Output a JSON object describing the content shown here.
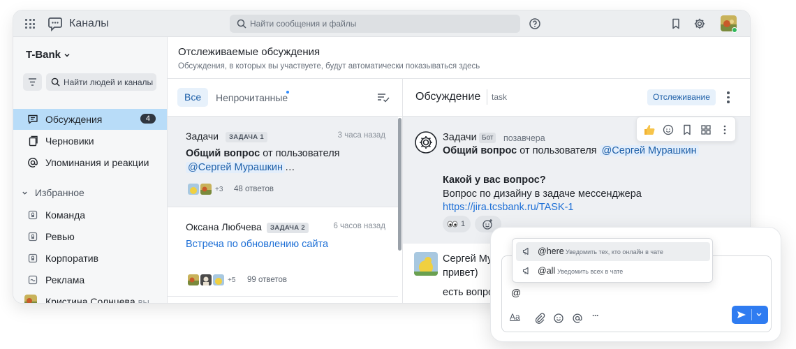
{
  "app": {
    "title": "Каналы",
    "search_placeholder": "Найти сообщения и файлы"
  },
  "sidebar": {
    "workspace": "T-Bank",
    "search_label": "Найти людей и каналы",
    "nav": [
      {
        "label": "Обсуждения",
        "count": "4",
        "icon": "threads-icon"
      },
      {
        "label": "Черновики",
        "icon": "drafts-icon"
      },
      {
        "label": "Упоминания и реакции",
        "icon": "at-icon"
      }
    ],
    "favorites_label": "Избранное",
    "channels": [
      {
        "label": "Команда",
        "icon": "lock-icon"
      },
      {
        "label": "Ревью",
        "icon": "lock-icon"
      },
      {
        "label": "Корпоратив",
        "icon": "lock-icon"
      },
      {
        "label": "Реклама",
        "icon": "tilde-icon"
      }
    ],
    "dm": {
      "name": "Кристина Солнцева",
      "suffix": "вы"
    }
  },
  "content": {
    "title": "Отслеживаемые обсуждения",
    "subtitle": "Обсуждения, в которых вы участвуете, будут автоматически показываться здесь"
  },
  "threads": {
    "tab_all": "Все",
    "tab_unread": "Непрочитанные",
    "items": [
      {
        "author": "Задачи",
        "tag": "ЗАДАЧА 1",
        "time": "3 часа назад",
        "text_bold": "Общий вопрос",
        "text_rest": " от пользователя",
        "mention": "@Сергей Мурашкин",
        "ellipsis": "…",
        "more": "+3",
        "replies": "48 ответов"
      },
      {
        "author": "Оксана Любчева",
        "tag": "ЗАДАЧА 2",
        "time": "6 часов назад",
        "link": "Встреча по обновлению сайта",
        "more": "+5",
        "replies": "99 ответов"
      }
    ]
  },
  "discussion": {
    "title": "Обсуждение",
    "tag": "task",
    "track_label": "Отслеживание",
    "message": {
      "author": "Задачи",
      "bot_tag": "Бот",
      "time": "позавчера",
      "line1_bold": "Общий вопрос",
      "line1_rest": " от пользователя",
      "mention": "@Сергей Мурашкин",
      "line2": "Какой у вас вопрос?",
      "line3": "Вопрос по дизайну в задаче мессенджера",
      "url": "https://jira.tcsbank.ru/TASK-1",
      "reaction_count": "1"
    },
    "message2": {
      "author": "Сергей Му",
      "line1": "привет)",
      "line2": "есть вопрос"
    }
  },
  "composer": {
    "input_value": "@",
    "suggestions": [
      {
        "key": "@here",
        "desc": "Уведомить тех, кто онлайн в чате"
      },
      {
        "key": "@all",
        "desc": "Уведомить всех в чате"
      }
    ],
    "format_label": "Aa",
    "more_label": "···"
  },
  "colors": {
    "accent": "#2f7cf1",
    "active_nav": "#b8dcf8",
    "mention_bg": "#e3eefb",
    "link": "#1d6fd6"
  }
}
